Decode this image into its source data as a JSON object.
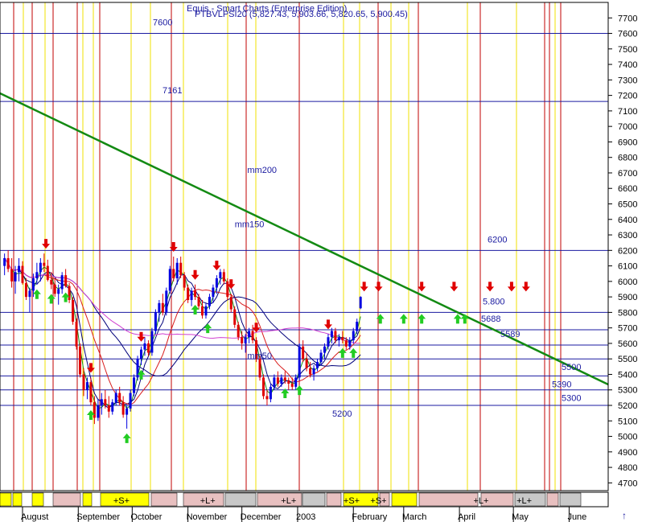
{
  "chart_data": {
    "type": "candlestick",
    "header": {
      "line1": "Equis - Smart Charts (Enterprise Edition)",
      "line2": "PTBVLPSI20 (5,827.43, 5,903.66, 5,820.65, 5,900.45)"
    },
    "ylim": [
      4650,
      7800
    ],
    "y_ticks": [
      4700,
      4800,
      4900,
      5000,
      5100,
      5200,
      5300,
      5400,
      5500,
      5600,
      5700,
      5800,
      5900,
      6000,
      6100,
      6200,
      6300,
      6400,
      6500,
      6600,
      6700,
      6800,
      6900,
      7000,
      7100,
      7200,
      7300,
      7400,
      7500,
      7600,
      7700
    ],
    "months": [
      {
        "label": "August",
        "day": 0
      },
      {
        "label": "September",
        "day": 31
      },
      {
        "label": "October",
        "day": 61
      },
      {
        "label": "November",
        "day": 92
      },
      {
        "label": "December",
        "day": 122
      },
      {
        "label": "2003",
        "day": 153
      },
      {
        "label": "February",
        "day": 184
      },
      {
        "label": "March",
        "day": 212
      },
      {
        "label": "April",
        "day": 243
      },
      {
        "label": "May",
        "day": 273
      },
      {
        "label": "June",
        "day": 304
      }
    ],
    "horizontal_levels": [
      {
        "value": 7600,
        "label": "7600"
      },
      {
        "value": 7161,
        "label": "7161"
      },
      {
        "value": 6200,
        "label": "6200"
      },
      {
        "value": 5800,
        "label": "5.800"
      },
      {
        "value": 5688,
        "label": "5688"
      },
      {
        "value": 5589,
        "label": "5589"
      },
      {
        "value": 5500,
        "label": "5500"
      },
      {
        "value": 5390,
        "label": "5390"
      },
      {
        "value": 5300,
        "label": "5300"
      },
      {
        "value": 5200,
        "label": "5200"
      }
    ],
    "ma_labels": [
      {
        "label": "mm200",
        "day": 125,
        "value": 6700
      },
      {
        "label": "mm150",
        "day": 118,
        "value": 6350
      },
      {
        "label": "mm50",
        "day": 125,
        "value": 5500
      }
    ],
    "candles": [
      [
        -10,
        6100,
        6180,
        6040,
        6150
      ],
      [
        -8,
        6150,
        6200,
        6060,
        6080
      ],
      [
        -6,
        6080,
        6150,
        5960,
        6000
      ],
      [
        -4,
        6000,
        6100,
        5920,
        6060
      ],
      [
        -2,
        6060,
        6150,
        6000,
        6100
      ],
      [
        0,
        6100,
        6130,
        5980,
        5990
      ],
      [
        2,
        5990,
        6020,
        5880,
        5900
      ],
      [
        4,
        5900,
        5960,
        5800,
        5940
      ],
      [
        6,
        5940,
        6050,
        5900,
        6020
      ],
      [
        8,
        6020,
        6120,
        5980,
        6060
      ],
      [
        10,
        6060,
        6150,
        6000,
        6120
      ],
      [
        12,
        6120,
        6180,
        6060,
        6100
      ],
      [
        14,
        6100,
        6140,
        6000,
        6010
      ],
      [
        16,
        6010,
        6060,
        5950,
        5980
      ],
      [
        18,
        5980,
        6020,
        5900,
        5920
      ],
      [
        20,
        5920,
        5980,
        5850,
        5950
      ],
      [
        22,
        5950,
        6060,
        5920,
        6040
      ],
      [
        24,
        6040,
        6080,
        5960,
        5970
      ],
      [
        26,
        5970,
        5990,
        5860,
        5880
      ],
      [
        28,
        5880,
        5900,
        5720,
        5740
      ],
      [
        30,
        5740,
        5760,
        5560,
        5580
      ],
      [
        32,
        5580,
        5600,
        5380,
        5400
      ],
      [
        34,
        5400,
        5440,
        5260,
        5300
      ],
      [
        36,
        5300,
        5380,
        5240,
        5350
      ],
      [
        38,
        5350,
        5380,
        5200,
        5220
      ],
      [
        40,
        5220,
        5260,
        5080,
        5120
      ],
      [
        42,
        5120,
        5240,
        5100,
        5200
      ],
      [
        44,
        5200,
        5280,
        5140,
        5240
      ],
      [
        46,
        5240,
        5300,
        5180,
        5200
      ],
      [
        48,
        5200,
        5260,
        5120,
        5160
      ],
      [
        50,
        5160,
        5240,
        5140,
        5220
      ],
      [
        52,
        5220,
        5300,
        5200,
        5280
      ],
      [
        54,
        5280,
        5320,
        5200,
        5220
      ],
      [
        56,
        5220,
        5260,
        5120,
        5140
      ],
      [
        58,
        5140,
        5200,
        5050,
        5180
      ],
      [
        60,
        5180,
        5300,
        5160,
        5280
      ],
      [
        62,
        5280,
        5400,
        5260,
        5380
      ],
      [
        64,
        5380,
        5520,
        5360,
        5500
      ],
      [
        66,
        5500,
        5580,
        5460,
        5560
      ],
      [
        68,
        5560,
        5640,
        5520,
        5600
      ],
      [
        70,
        5600,
        5620,
        5520,
        5540
      ],
      [
        72,
        5540,
        5700,
        5520,
        5680
      ],
      [
        74,
        5680,
        5820,
        5660,
        5800
      ],
      [
        76,
        5800,
        5880,
        5740,
        5860
      ],
      [
        78,
        5860,
        5920,
        5780,
        5800
      ],
      [
        80,
        5800,
        5960,
        5780,
        5940
      ],
      [
        82,
        5940,
        6100,
        5920,
        6080
      ],
      [
        84,
        6080,
        6160,
        6000,
        6020
      ],
      [
        86,
        6020,
        6150,
        5980,
        6120
      ],
      [
        88,
        6120,
        6160,
        6020,
        6040
      ],
      [
        90,
        6040,
        6060,
        5940,
        5960
      ],
      [
        92,
        5960,
        5980,
        5860,
        5880
      ],
      [
        94,
        5880,
        5960,
        5840,
        5940
      ],
      [
        96,
        5940,
        5980,
        5880,
        5900
      ],
      [
        98,
        5900,
        5920,
        5820,
        5840
      ],
      [
        100,
        5840,
        5880,
        5760,
        5780
      ],
      [
        102,
        5780,
        5860,
        5760,
        5840
      ],
      [
        104,
        5840,
        5920,
        5820,
        5900
      ],
      [
        106,
        5900,
        5980,
        5860,
        5960
      ],
      [
        108,
        5960,
        6040,
        5920,
        6020
      ],
      [
        110,
        6020,
        6080,
        5980,
        6060
      ],
      [
        112,
        6060,
        6080,
        5980,
        6000
      ],
      [
        114,
        6000,
        6020,
        5880,
        5900
      ],
      [
        116,
        5900,
        5920,
        5800,
        5820
      ],
      [
        118,
        5820,
        5840,
        5700,
        5720
      ],
      [
        120,
        5720,
        5740,
        5620,
        5640
      ],
      [
        122,
        5640,
        5680,
        5560,
        5600
      ],
      [
        124,
        5600,
        5660,
        5540,
        5640
      ],
      [
        126,
        5640,
        5700,
        5600,
        5680
      ],
      [
        128,
        5680,
        5720,
        5600,
        5620
      ],
      [
        130,
        5620,
        5640,
        5480,
        5500
      ],
      [
        132,
        5500,
        5520,
        5360,
        5380
      ],
      [
        134,
        5380,
        5400,
        5240,
        5260
      ],
      [
        136,
        5260,
        5300,
        5200,
        5240
      ],
      [
        138,
        5240,
        5340,
        5220,
        5320
      ],
      [
        140,
        5320,
        5400,
        5300,
        5380
      ],
      [
        142,
        5380,
        5420,
        5320,
        5340
      ],
      [
        144,
        5340,
        5400,
        5320,
        5380
      ],
      [
        146,
        5380,
        5420,
        5340,
        5360
      ],
      [
        148,
        5360,
        5380,
        5300,
        5340
      ],
      [
        150,
        5340,
        5380,
        5300,
        5320
      ],
      [
        152,
        5320,
        5400,
        5300,
        5380
      ],
      [
        154,
        5380,
        5600,
        5360,
        5580
      ],
      [
        156,
        5580,
        5620,
        5480,
        5500
      ],
      [
        158,
        5500,
        5540,
        5420,
        5440
      ],
      [
        160,
        5440,
        5480,
        5380,
        5400
      ],
      [
        162,
        5400,
        5460,
        5360,
        5440
      ],
      [
        164,
        5440,
        5500,
        5420,
        5480
      ],
      [
        166,
        5480,
        5560,
        5460,
        5540
      ],
      [
        168,
        5540,
        5600,
        5500,
        5580
      ],
      [
        170,
        5580,
        5660,
        5560,
        5640
      ],
      [
        172,
        5640,
        5700,
        5600,
        5680
      ],
      [
        174,
        5680,
        5700,
        5600,
        5620
      ],
      [
        176,
        5620,
        5660,
        5580,
        5640
      ],
      [
        178,
        5640,
        5680,
        5600,
        5620
      ],
      [
        180,
        5620,
        5640,
        5560,
        5580
      ],
      [
        182,
        5580,
        5640,
        5560,
        5620
      ],
      [
        184,
        5620,
        5700,
        5600,
        5680
      ],
      [
        186,
        5680,
        5760,
        5660,
        5740
      ],
      [
        188,
        5827,
        5904,
        5821,
        5900
      ]
    ],
    "buy_arrows": [
      8,
      16,
      24,
      38,
      58,
      66,
      96,
      103,
      146,
      154,
      178,
      184,
      199,
      212,
      222,
      242,
      246
    ],
    "sell_arrows": [
      13,
      38,
      66,
      84,
      96,
      108,
      116,
      130,
      170,
      190,
      198,
      222,
      240,
      260,
      272,
      280
    ],
    "signal_bands": [
      {
        "label": "+S+",
        "day": 55
      },
      {
        "label": "+L+",
        "day": 103
      },
      {
        "label": "+L+",
        "day": 148
      },
      {
        "label": "+S+",
        "day": 183
      },
      {
        "label": "+S+",
        "day": 198
      },
      {
        "label": "+L+",
        "day": 255
      },
      {
        "label": "+L+",
        "day": 279
      }
    ]
  }
}
